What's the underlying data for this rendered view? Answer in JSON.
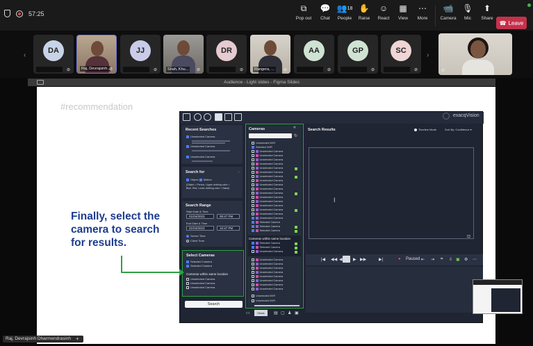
{
  "topbar": {
    "timer": "57:25",
    "items": [
      {
        "label": "Pop out",
        "icon": "popout-icon"
      },
      {
        "label": "Chat",
        "icon": "chat-icon"
      },
      {
        "label": "People",
        "icon": "people-icon",
        "count": "18"
      },
      {
        "label": "Raise",
        "icon": "raise-hand-icon"
      },
      {
        "label": "React",
        "icon": "react-icon"
      },
      {
        "label": "View",
        "icon": "view-icon"
      },
      {
        "label": "More",
        "icon": "more-icon"
      },
      {
        "label": "Camera",
        "icon": "camera-icon"
      },
      {
        "label": "Mic",
        "icon": "mic-icon"
      },
      {
        "label": "Share",
        "icon": "share-icon"
      }
    ],
    "leave_label": "Leave"
  },
  "participants": [
    {
      "initials": "DA",
      "name": "",
      "color": "#c7d4e8"
    },
    {
      "initials": "",
      "name": "Raj, Devrajsinh...",
      "photo": true,
      "selected": true
    },
    {
      "initials": "JJ",
      "name": "",
      "color": "#c9cbe9"
    },
    {
      "initials": "",
      "name": "Shah, Khu...",
      "photo": true
    },
    {
      "initials": "DR",
      "name": "",
      "color": "#e6cbd1"
    },
    {
      "initials": "",
      "name": "Rangera, ...",
      "photo": true
    },
    {
      "initials": "AA",
      "name": "",
      "color": "#cfe3d3"
    },
    {
      "initials": "GP",
      "name": "",
      "color": "#cfe3d3"
    },
    {
      "initials": "SC",
      "name": "",
      "color": "#efd5d5"
    }
  ],
  "share_bar": {
    "title": "Audience - Light slides - Figma Slides"
  },
  "slide": {
    "hashtag": "#recommendation",
    "headline": "Finally, select the camera to search for results.",
    "app": {
      "brand": "exacqVision",
      "recent_searches": {
        "title": "Recent Searches",
        "items": [
          "Unselected Camera",
          "Unselected Camera",
          "Unselected Camera"
        ]
      },
      "search_for": {
        "title": "Search for",
        "options": [
          "Object",
          "Motion"
        ],
        "note": "(Object = Person, Upper clothing color = Blue, Red, Lower clothing color = Black)"
      },
      "search_range": {
        "title": "Search Range",
        "start_label": "Start Date & Time",
        "start_date": "01/04/2023",
        "start_time": "08:47 PM",
        "end_label": "End Date & Time",
        "end_date": "01/04/2023",
        "end_time": "10:47 PM",
        "tz": [
          "Server Time",
          "Client Time"
        ]
      },
      "selected_cameras": {
        "title": "Select Cameras",
        "items": [
          "Selected Camera",
          "Selected Camera"
        ],
        "within_title": "Cameras within same location",
        "within_items": [
          "Unselected Camera",
          "Unselected Camera",
          "Unselected Camera"
        ]
      },
      "search_button": "Search",
      "cameras_panel": {
        "title": "Cameras",
        "groups": [
          "Unselected NVR",
          "Selected NVR"
        ],
        "row_label": "Unselected Camera",
        "selected_label": "Selected Camera",
        "within_title": "Cameras within same location",
        "footer": [
          "Unselected NVR",
          "Unselected NVR"
        ]
      },
      "results": {
        "title": "Search Results",
        "timeline_mode": "Timeline Mode",
        "sort": "Sort By: Confidence",
        "player_status": "Paused"
      },
      "bottom_tab": "Views"
    }
  },
  "presenter_label": "Raj, Devrajsinh Dharmendrasinh",
  "colors": {
    "leave": "#c4314b",
    "highlight": "#2ea043",
    "headline": "#1d3c8f",
    "app_bg": "#1f2533"
  }
}
